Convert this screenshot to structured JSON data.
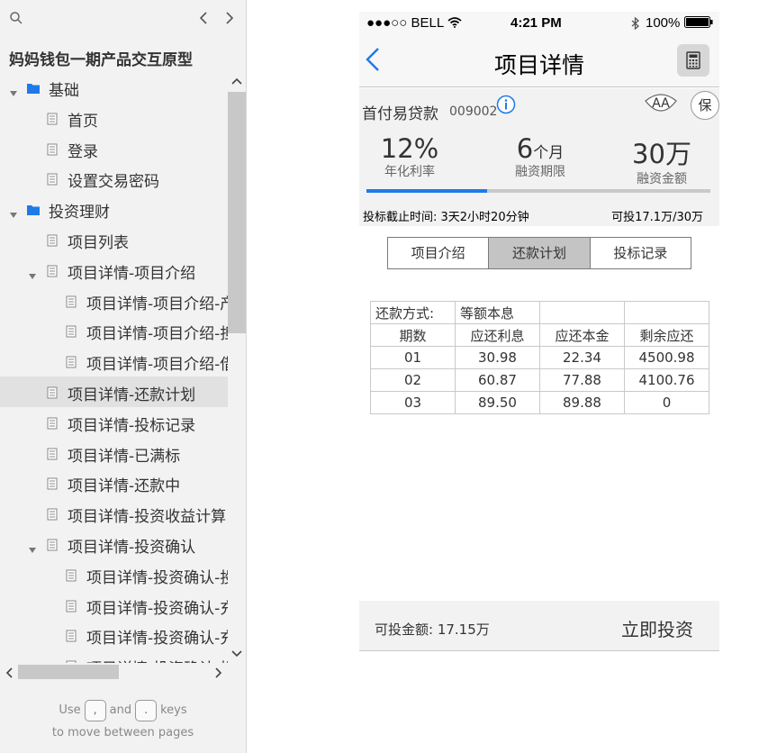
{
  "sidebar": {
    "title": "妈妈钱包一期产品交互原型",
    "items": [
      {
        "label": "基础",
        "level": 0,
        "type": "folder",
        "expanded": true
      },
      {
        "label": "首页",
        "level": 1,
        "type": "page"
      },
      {
        "label": "登录",
        "level": 1,
        "type": "page"
      },
      {
        "label": "设置交易密码",
        "level": 1,
        "type": "page"
      },
      {
        "label": "投资理财",
        "level": 0,
        "type": "folder",
        "expanded": true
      },
      {
        "label": "项目列表",
        "level": 1,
        "type": "page"
      },
      {
        "label": "项目详情-项目介绍",
        "level": 1,
        "type": "page",
        "expanded": true
      },
      {
        "label": "项目详情-项目介绍-产",
        "level": 2,
        "type": "page"
      },
      {
        "label": "项目详情-项目介绍-担",
        "level": 2,
        "type": "page"
      },
      {
        "label": "项目详情-项目介绍-借",
        "level": 2,
        "type": "page"
      },
      {
        "label": "项目详情-还款计划",
        "level": 1,
        "type": "page",
        "selected": true
      },
      {
        "label": "项目详情-投标记录",
        "level": 1,
        "type": "page"
      },
      {
        "label": "项目详情-已满标",
        "level": 1,
        "type": "page"
      },
      {
        "label": "项目详情-还款中",
        "level": 1,
        "type": "page"
      },
      {
        "label": "项目详情-投资收益计算",
        "level": 1,
        "type": "page"
      },
      {
        "label": "项目详情-投资确认",
        "level": 1,
        "type": "page",
        "expanded": true
      },
      {
        "label": "项目详情-投资确认-投",
        "level": 2,
        "type": "page"
      },
      {
        "label": "项目详情-投资确认-充",
        "level": 2,
        "type": "page"
      },
      {
        "label": "项目详情-投资确认-充",
        "level": 2,
        "type": "page"
      },
      {
        "label": "项目详情-投资确认-投",
        "level": 2,
        "type": "page"
      }
    ],
    "hint": {
      "use": "Use",
      "and": "and",
      "keys": "keys",
      "line2": "to move between pages",
      "key_prev": ",",
      "key_next": "."
    }
  },
  "status_bar": {
    "carrier": "●●●○○ BELL",
    "time": "4:21 PM",
    "battery": "100%"
  },
  "nav": {
    "title": "项目详情"
  },
  "product": {
    "name": "首付易贷款",
    "code": "009002",
    "aa_label": "AA",
    "bao_label": "保",
    "rate_value": "12%",
    "rate_label": "年化利率",
    "term_value": "6",
    "term_unit": "个月",
    "term_label": "融资期限",
    "amount_value": "30万",
    "amount_label": "融资金额",
    "progress_fraction": 0.35,
    "deadline": "投标截止时间: 3天2小时20分钟",
    "available": "可投17.1万/30万"
  },
  "tabs": [
    {
      "label": "项目介绍",
      "active": false
    },
    {
      "label": "还款计划",
      "active": true
    },
    {
      "label": "投标记录",
      "active": false
    }
  ],
  "repayment": {
    "method_label": "还款方式:",
    "method_value": "等额本息",
    "headers": [
      "期数",
      "应还利息",
      "应还本金",
      "剩余应还"
    ],
    "rows": [
      [
        "01",
        "30.98",
        "22.34",
        "4500.98"
      ],
      [
        "02",
        "60.87",
        "77.88",
        "4100.76"
      ],
      [
        "03",
        "89.50",
        "89.88",
        "0"
      ]
    ]
  },
  "footer": {
    "available_label": "可投金额:   17.15万",
    "invest_button": "立即投资"
  },
  "colors": {
    "accent": "#1e7ae8",
    "selected_row": "#e1e1e1",
    "sidebar_bg": "#f2f2f2"
  }
}
